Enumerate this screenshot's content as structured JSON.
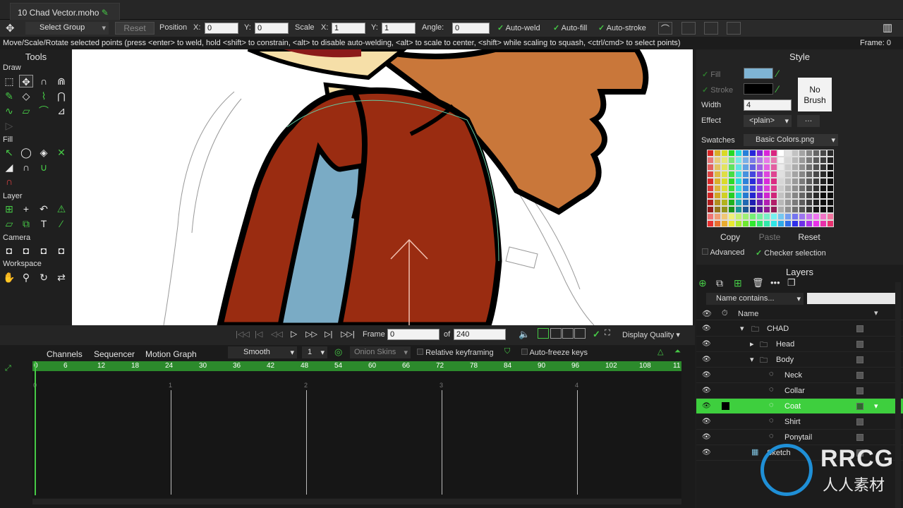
{
  "window": {
    "doc_tab": "10 Chad Vector.moho"
  },
  "options_bar": {
    "tool_mode": "Select Group",
    "reset": "Reset",
    "position_label": "Position",
    "x_label": "X:",
    "x_value": "0",
    "y_label": "Y:",
    "y_value": "0",
    "scale_label": "Scale",
    "sx_label": "X:",
    "sx_value": "1",
    "sy_label": "Y:",
    "sy_value": "1",
    "angle_label": "Angle:",
    "angle_value": "0",
    "auto_weld": "Auto-weld",
    "auto_fill": "Auto-fill",
    "auto_stroke": "Auto-stroke"
  },
  "status": {
    "message": "Move/Scale/Rotate selected points (press <enter> to weld, hold <shift> to constrain, <alt> to disable auto-welding, <alt> to scale to center, <shift> while scaling to squash, <ctrl/cmd> to select points)",
    "frame": "Frame: 0"
  },
  "tools": {
    "title": "Tools",
    "draw": "Draw",
    "fill": "Fill",
    "layer": "Layer",
    "camera": "Camera",
    "workspace": "Workspace"
  },
  "style": {
    "title": "Style",
    "fill": "Fill",
    "stroke": "Stroke",
    "width_label": "Width",
    "width_value": "4",
    "effect_label": "Effect",
    "effect_value": "<plain>",
    "no_brush": "No Brush",
    "swatches_label": "Swatches",
    "swatches_value": "Basic Colors.png",
    "copy": "Copy",
    "paste": "Paste",
    "reset": "Reset",
    "advanced": "Advanced",
    "checker": "Checker selection",
    "fill_color": "#7fb4d4",
    "stroke_color": "#000000"
  },
  "layers": {
    "title": "Layers",
    "filter": "Name contains...",
    "name_header": "Name",
    "rows": [
      {
        "name": "CHAD"
      },
      {
        "name": "Head"
      },
      {
        "name": "Body"
      },
      {
        "name": "Neck"
      },
      {
        "name": "Collar"
      },
      {
        "name": "Coat"
      },
      {
        "name": "Shirt"
      },
      {
        "name": "Ponytail"
      },
      {
        "name": "Sketch"
      }
    ]
  },
  "playback": {
    "frame_label": "Frame",
    "frame_value": "0",
    "of_label": "of",
    "total": "240",
    "display_quality": "Display Quality"
  },
  "timeline": {
    "tabs": [
      "Channels",
      "Sequencer",
      "Motion Graph"
    ],
    "interp": "Smooth",
    "interp_count": "1",
    "onion": "Onion Skins",
    "relative": "Relative keyframing",
    "auto_freeze": "Auto-freeze keys",
    "ruler": [
      "0",
      "6",
      "12",
      "18",
      "24",
      "30",
      "36",
      "42",
      "48",
      "54",
      "60",
      "66",
      "72",
      "78",
      "84",
      "90",
      "96",
      "102",
      "108",
      "11"
    ],
    "seconds": [
      "0",
      "1",
      "2",
      "3",
      "4"
    ]
  },
  "watermark": {
    "brand": "RRCG",
    "cn": "人人素材"
  }
}
